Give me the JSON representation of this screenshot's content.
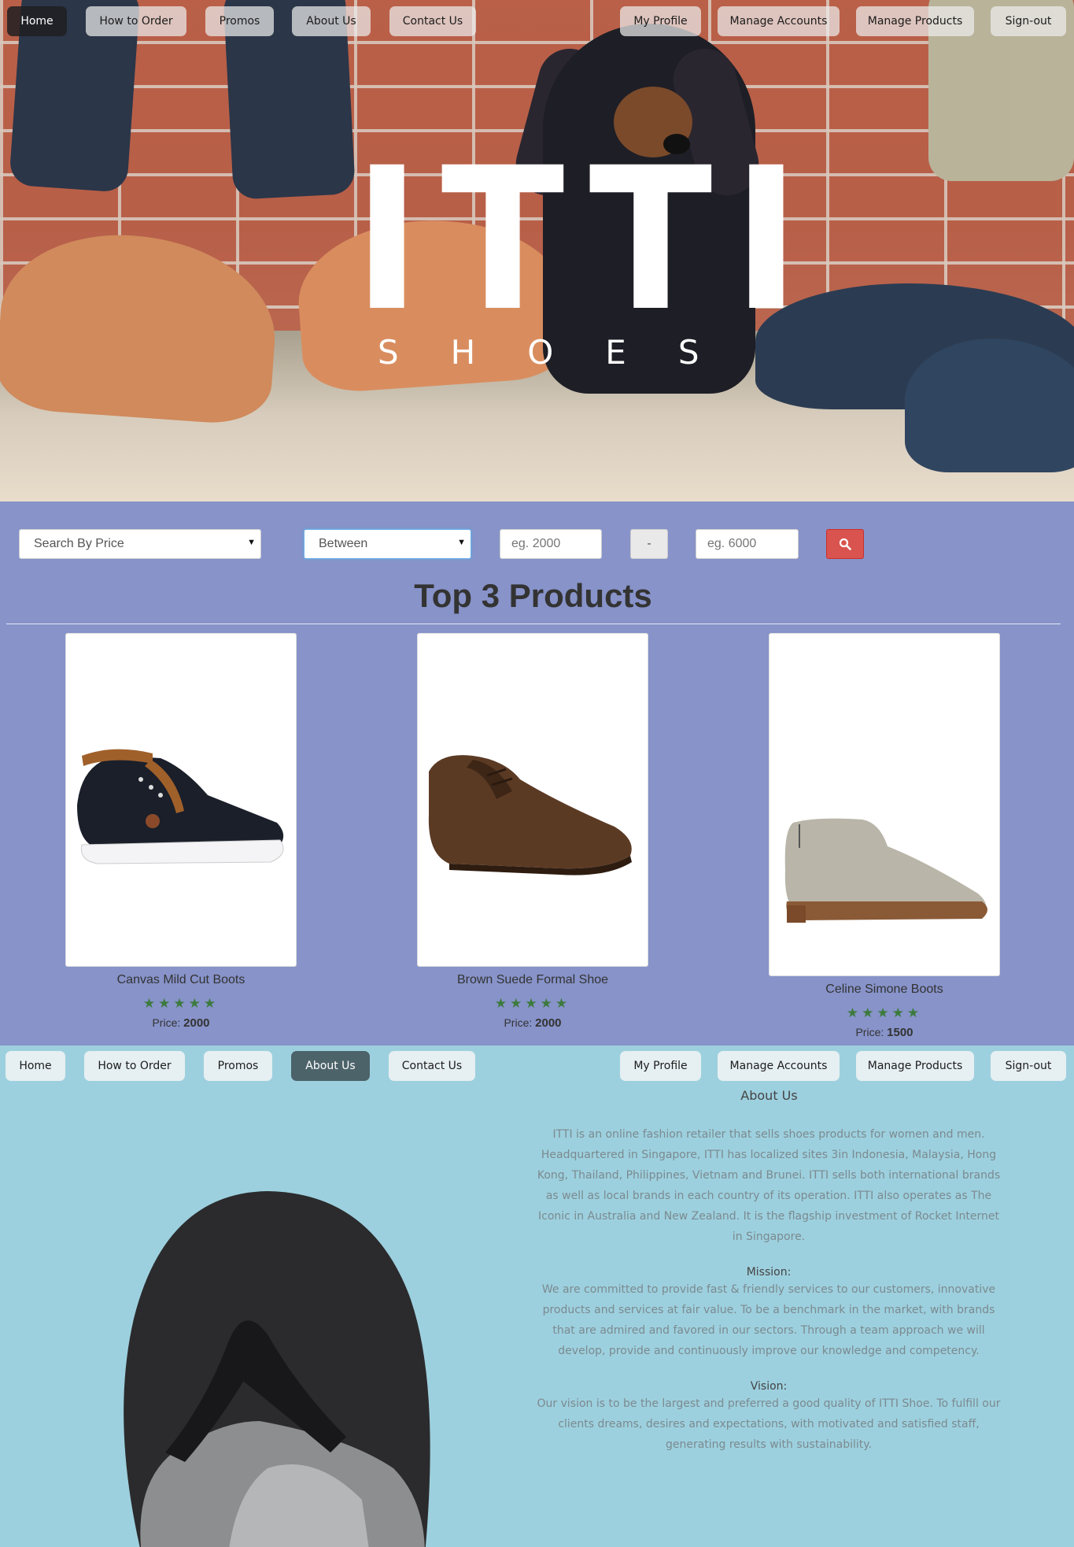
{
  "nav": {
    "left_items": [
      {
        "label": "Home"
      },
      {
        "label": "How to Order"
      },
      {
        "label": "Promos"
      },
      {
        "label": "About Us"
      },
      {
        "label": "Contact Us"
      }
    ],
    "right_items": [
      {
        "label": "My Profile"
      },
      {
        "label": "Manage Accounts"
      },
      {
        "label": "Manage Products"
      },
      {
        "label": "Sign-out"
      }
    ],
    "top_active": "Home",
    "bottom_active": "About Us"
  },
  "hero": {
    "logo_main": "ITTI",
    "logo_sub": "SHOES"
  },
  "search": {
    "filter_select": "Search By Price",
    "mode_select": "Between",
    "min_placeholder": "eg. 2000",
    "separator": "-",
    "max_placeholder": "eg. 6000",
    "button_icon": "search-icon"
  },
  "products_section": {
    "title": "Top 3 Products",
    "products": [
      {
        "name": "Canvas Mild Cut Boots",
        "rating": 5,
        "price_label": "Price:",
        "price": "2000"
      },
      {
        "name": "Brown Suede Formal Shoe",
        "rating": 5,
        "price_label": "Price:",
        "price": "2000"
      },
      {
        "name": "Celine Simone Boots",
        "rating": 5,
        "price_label": "Price:",
        "price": "1500"
      }
    ]
  },
  "about": {
    "title": "About Us",
    "intro": "ITTI is an online fashion retailer that sells shoes products for women and men. Headquartered in Singapore, ITTI has localized sites 3in Indonesia, Malaysia, Hong Kong, Thailand, Philippines, Vietnam and Brunei. ITTI sells both international brands as well as local brands in each country of its operation. ITTI also operates as The Iconic in Australia and New Zealand. It is the flagship investment of Rocket Internet in Singapore.",
    "mission_heading": "Mission:",
    "mission": "We are committed to provide fast & friendly services to our customers, innovative products and services at fair value. To be a benchmark in the market, with brands that are admired and favored in our sectors. Through a team approach we will develop, provide and continuously improve our knowledge and competency.",
    "vision_heading": "Vision:",
    "vision": "Our vision is to be the largest and preferred a good quality of ITTI Shoe. To fulfill our clients dreams, desires and expectations, with motivated and satisfied staff, generating results with sustainability."
  },
  "colors": {
    "purple_section": "#8793c9",
    "about_section": "#9dd0de",
    "search_button": "#d9534f",
    "star": "#3d7a3d"
  }
}
